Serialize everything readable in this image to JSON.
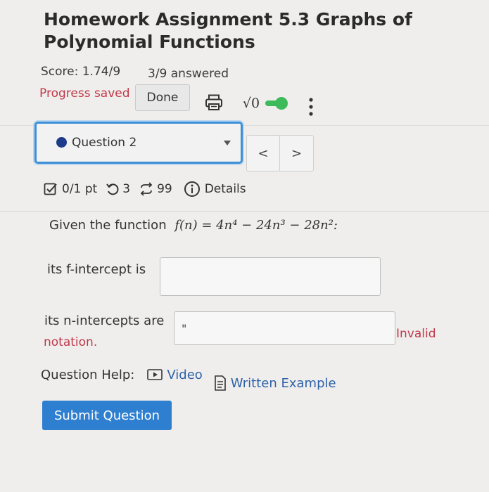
{
  "assignment": {
    "title_line1": "Homework Assignment 5.3 Graphs of",
    "title_line2": "Polynomial Functions",
    "score": "Score: 1.74/9",
    "answered": "3/9 answered",
    "progress_saved": "Progress saved",
    "done_label": "Done",
    "sqrt_label": "√0"
  },
  "question_nav": {
    "selected_label": "Question 2",
    "prev_symbol": "<",
    "next_symbol": ">"
  },
  "question_meta": {
    "points": "0/1 pt",
    "retries": "3",
    "submissions": "99",
    "details_label": "Details"
  },
  "question": {
    "prompt_prefix": "Given the function",
    "function_text": "f(n) = 4n⁴ − 24n³ − 28n²:",
    "f_intercept_label": "its f-intercept is",
    "f_intercept_value": "",
    "n_intercepts_label": "its n-intercepts are",
    "n_intercepts_value": "\"",
    "invalid_text": "Invalid",
    "notation_text": "notation."
  },
  "help": {
    "label": "Question Help:",
    "video_label": "Video",
    "written_example_label": "Written Example"
  },
  "submit_label": "Submit Question",
  "colors": {
    "accent_blue": "#3d8fd6",
    "error_red": "#c0394b",
    "toggle_green": "#3dba5a",
    "submit_blue": "#2f7fd0"
  }
}
